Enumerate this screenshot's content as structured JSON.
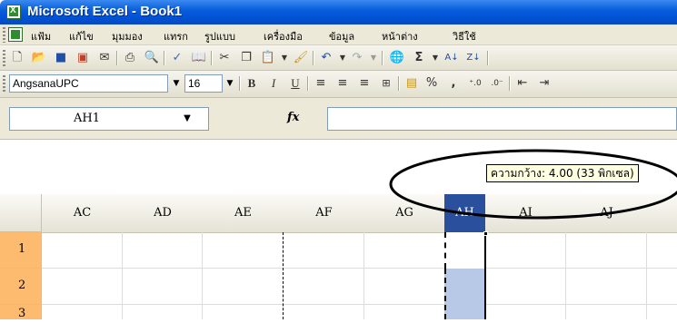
{
  "window": {
    "title": "Microsoft Excel - Book1"
  },
  "menu": {
    "items": [
      "แฟ้ม",
      "แก้ไข",
      "มุมมอง",
      "แทรก",
      "รูปแบบ",
      "เครื่องมือ",
      "ข้อมูล",
      "หน้าต่าง",
      "วิธีใช้"
    ]
  },
  "standard_toolbar": {
    "buttons": [
      "new-icon",
      "open-icon",
      "save-icon",
      "permission-icon",
      "print-icon",
      "print-preview-icon",
      "spelling-icon",
      "research-icon",
      "cut-icon",
      "copy-icon",
      "paste-icon",
      "format-painter-icon",
      "undo-icon",
      "redo-icon",
      "hyperlink-icon",
      "autosum-icon",
      "sort-ascending-icon",
      "sort-descending-icon"
    ]
  },
  "formatting_toolbar": {
    "font_name": "AngsanaUPC",
    "font_size": "16",
    "bold_label": "B",
    "italic_label": "I",
    "underline_label": "U",
    "percent_label": "%",
    "comma_label": ","
  },
  "formula_bar": {
    "name_box": "AH1",
    "fx_label": "fx",
    "formula": ""
  },
  "columns": [
    {
      "label": "AC",
      "selected": false
    },
    {
      "label": "AD",
      "selected": false
    },
    {
      "label": "AE",
      "selected": false
    },
    {
      "label": "AF",
      "selected": false
    },
    {
      "label": "AG",
      "selected": false
    },
    {
      "label": "AH",
      "selected": true
    },
    {
      "label": "AI",
      "selected": false
    },
    {
      "label": "AJ",
      "selected": false
    }
  ],
  "rows": [
    "1",
    "2",
    "3"
  ],
  "tooltip": {
    "text": "ความกว้าง: 4.00 (33 พิกเซล)"
  },
  "colors": {
    "title_bar": "#0a5fdc",
    "selected_column_header": "#2a4f9c",
    "row_header": "#fdbb6f",
    "selected_cell_fill": "#b8c9e8",
    "tooltip_bg": "#ffffe1"
  }
}
